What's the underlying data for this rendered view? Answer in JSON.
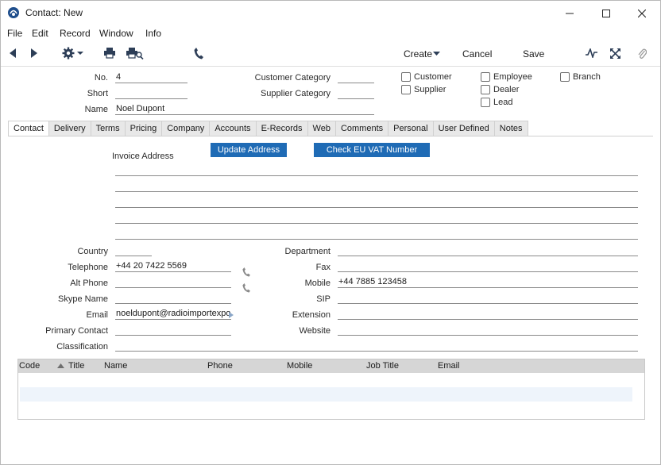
{
  "window": {
    "title": "Contact: New"
  },
  "menu": [
    "File",
    "Edit",
    "Record",
    "Window",
    "Info"
  ],
  "toolbar": {
    "create": "Create",
    "cancel": "Cancel",
    "save": "Save"
  },
  "header": {
    "no_label": "No.",
    "no_value": "4",
    "short_label": "Short",
    "short_value": "",
    "name_label": "Name",
    "name_value": "Noel Dupont",
    "customer_category_label": "Customer Category",
    "customer_category_value": "",
    "supplier_category_label": "Supplier Category",
    "supplier_category_value": "",
    "checkboxes": {
      "customer": "Customer",
      "supplier": "Supplier",
      "employee": "Employee",
      "dealer": "Dealer",
      "lead": "Lead",
      "branch": "Branch"
    }
  },
  "tabs": [
    "Contact",
    "Delivery",
    "Terms",
    "Pricing",
    "Company",
    "Accounts",
    "E-Records",
    "Web",
    "Comments",
    "Personal",
    "User Defined",
    "Notes"
  ],
  "active_tab": "Contact",
  "contact": {
    "update_address": "Update Address",
    "check_vat": "Check EU VAT Number",
    "invoice_address_label": "Invoice Address",
    "country_label": "Country",
    "country_value": "",
    "telephone_label": "Telephone",
    "telephone_value": "+44 20 7422 5569",
    "alt_phone_label": "Alt Phone",
    "alt_phone_value": "",
    "skype_label": "Skype Name",
    "skype_value": "",
    "email_label": "Email",
    "email_value": "noeldupont@radioimportexpo",
    "primary_contact_label": "Primary Contact",
    "primary_contact_value": "",
    "classification_label": "Classification",
    "classification_value": "",
    "department_label": "Department",
    "department_value": "",
    "fax_label": "Fax",
    "fax_value": "",
    "mobile_label": "Mobile",
    "mobile_value": "+44 7885 123458",
    "sip_label": "SIP",
    "sip_value": "",
    "extension_label": "Extension",
    "extension_value": "",
    "website_label": "Website",
    "website_value": ""
  },
  "list": {
    "columns": [
      "Code",
      "Title",
      "Name",
      "Phone",
      "Mobile",
      "Job Title",
      "Email"
    ]
  },
  "colors": {
    "accent": "#1f6bb5",
    "header_bg": "#d6d6d6",
    "row_highlight": "#eef4fb"
  }
}
